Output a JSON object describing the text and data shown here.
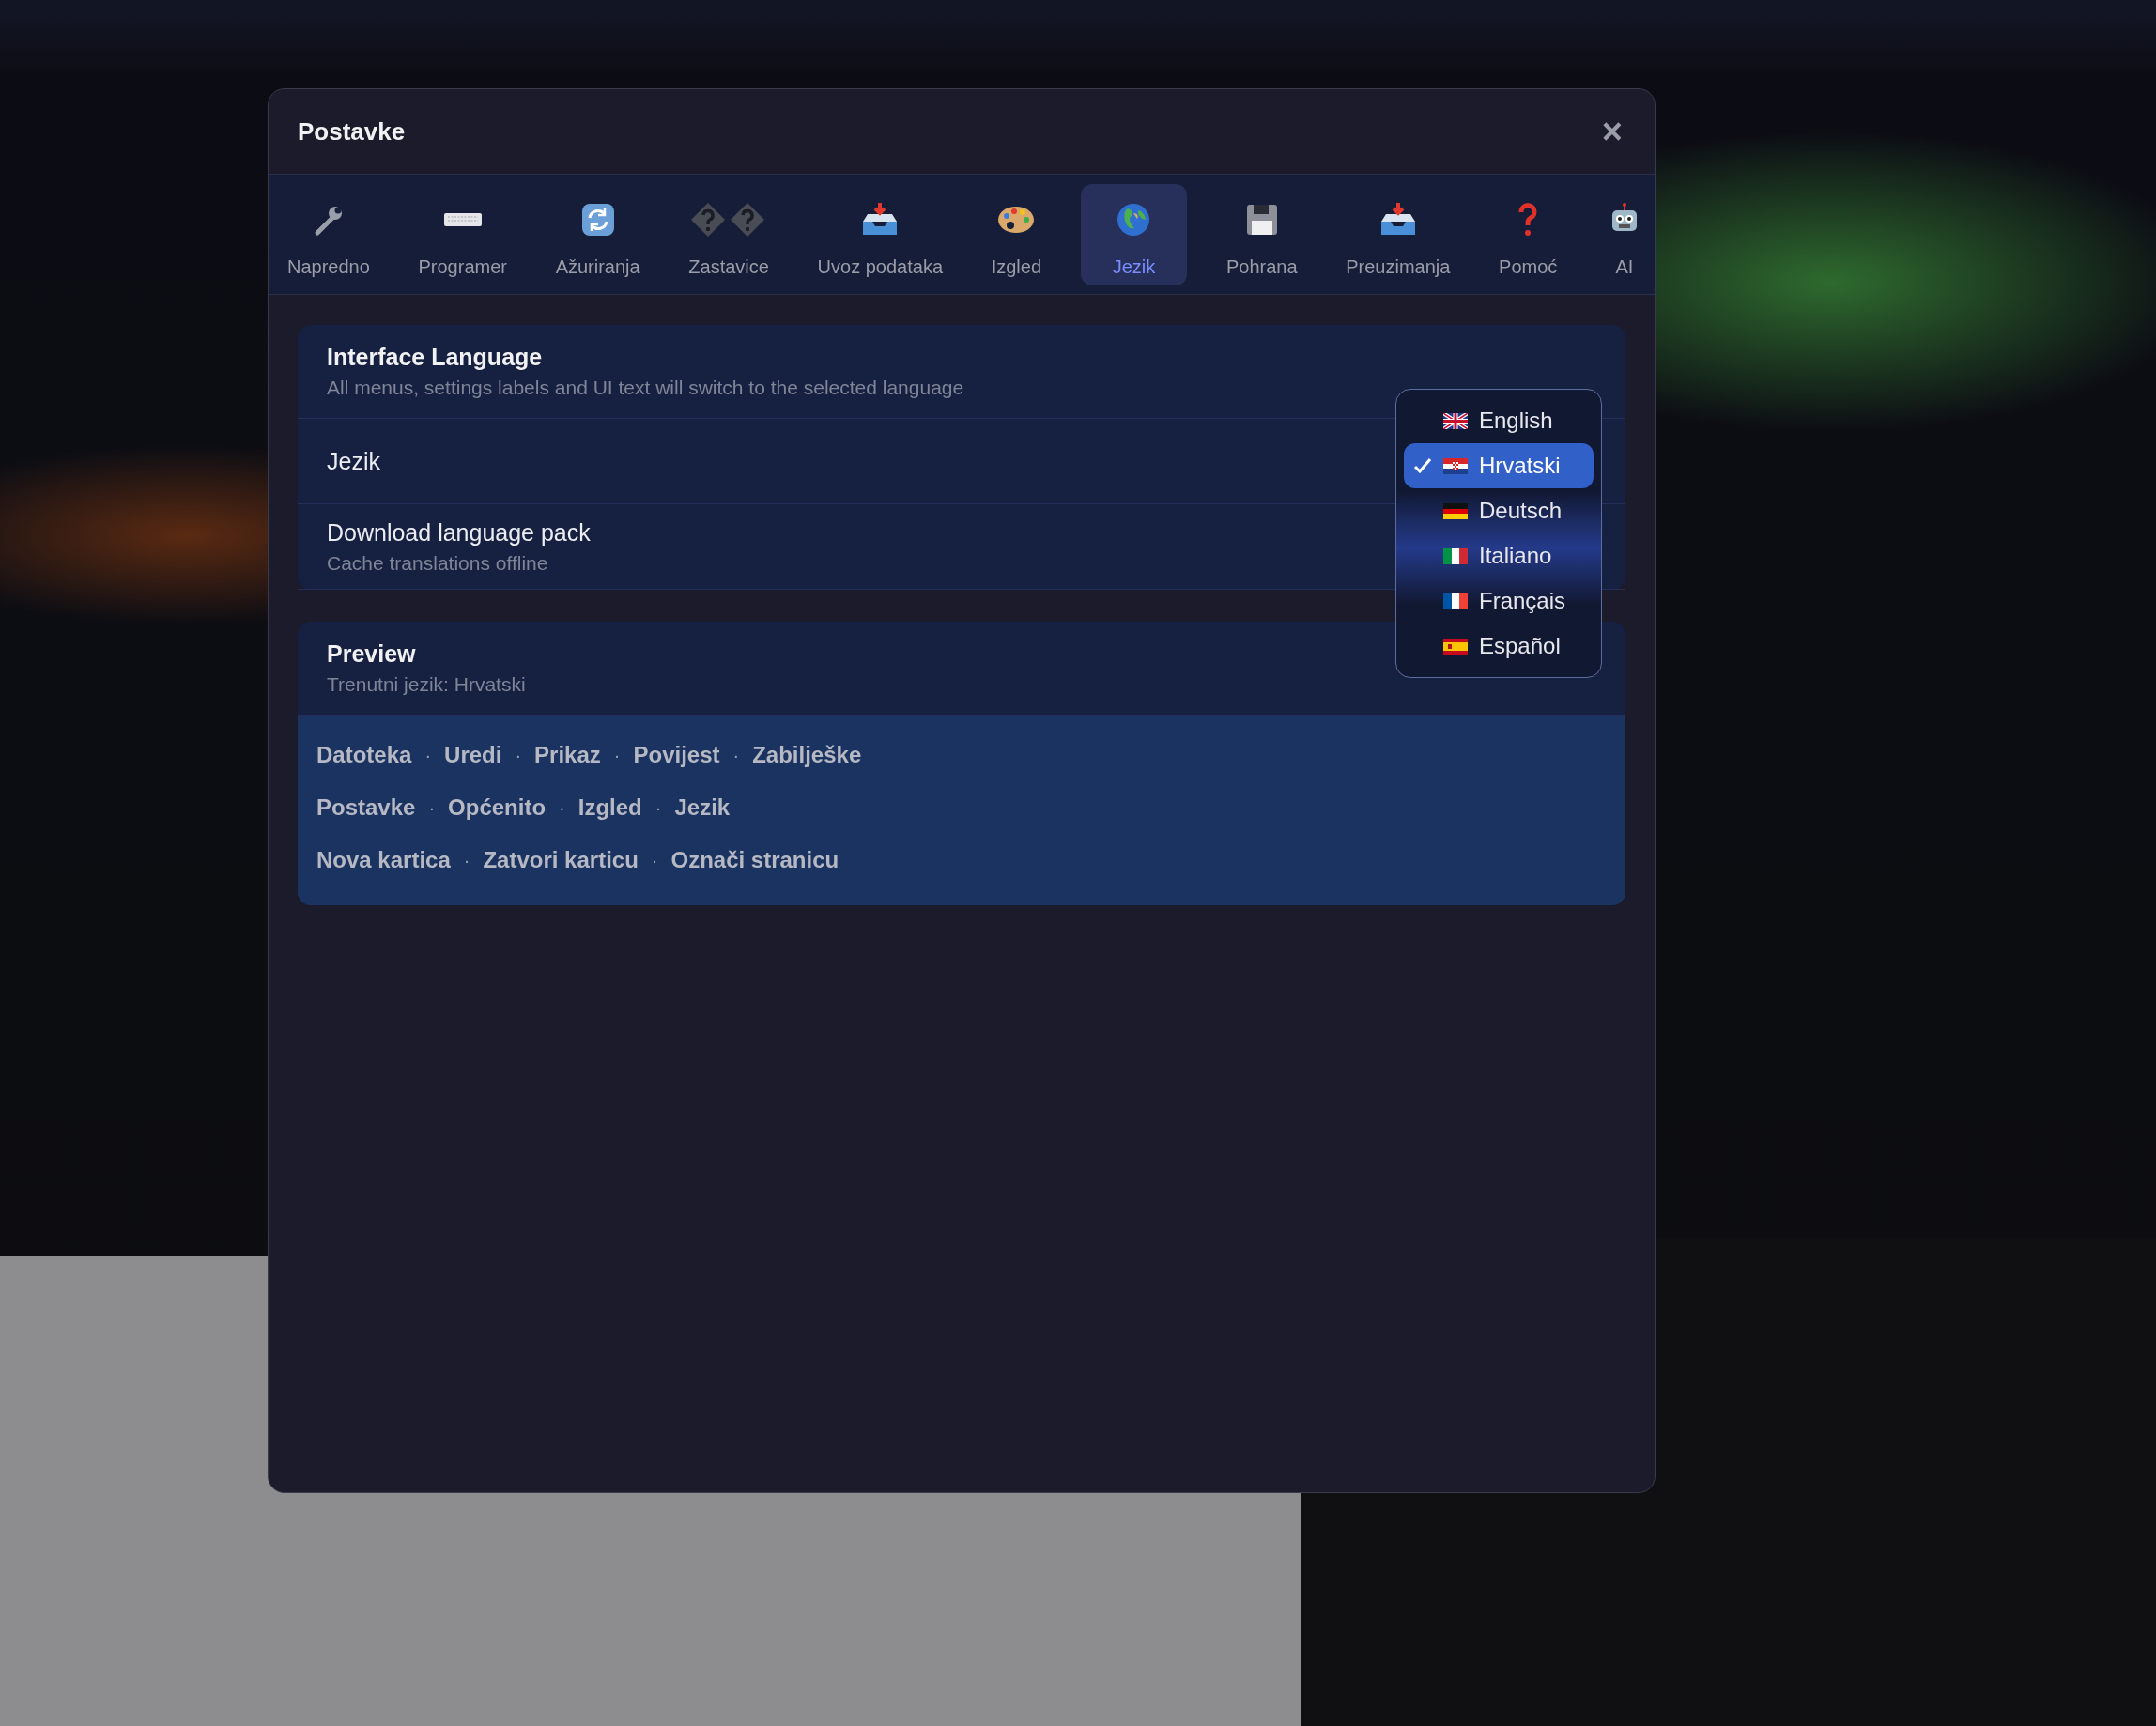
{
  "dialog": {
    "title": "Postavke",
    "close": "×"
  },
  "tabs": [
    {
      "label": "Napredno",
      "selected": false
    },
    {
      "label": "Programer",
      "selected": false
    },
    {
      "label": "Ažuriranja",
      "selected": false
    },
    {
      "label": "Zastavice",
      "selected": false
    },
    {
      "label": "Uvoz podataka",
      "selected": false
    },
    {
      "label": "Izgled",
      "selected": false
    },
    {
      "label": "Jezik",
      "selected": true
    },
    {
      "label": "Pohrana",
      "selected": false
    },
    {
      "label": "Preuzimanja",
      "selected": false
    },
    {
      "label": "Pomoć",
      "selected": false
    },
    {
      "label": "AI",
      "selected": false
    }
  ],
  "language_card": {
    "title": "Interface Language",
    "description": "All menus, settings labels and UI text will switch to the selected language",
    "rows": [
      {
        "label": "Jezik"
      },
      {
        "label": "Download language pack",
        "description": "Cache translations offline"
      }
    ]
  },
  "language_menu": [
    {
      "label": "English",
      "selected": false
    },
    {
      "label": "Hrvatski",
      "selected": true
    },
    {
      "label": "Deutsch",
      "selected": false
    },
    {
      "label": "Italiano",
      "selected": false
    },
    {
      "label": "Français",
      "selected": false
    },
    {
      "label": "Español",
      "selected": false
    }
  ],
  "preview": {
    "title": "Preview",
    "subtitle": "Trenutni jezik: Hrvatski",
    "lines": [
      [
        "Datoteka",
        "·",
        "Uredi",
        "·",
        "Prikaz",
        "·",
        "Povijest",
        "·",
        "Zabilješke"
      ],
      [
        "Postavke",
        "·",
        "Općenito",
        "·",
        "Izgled",
        "·",
        "Jezik"
      ],
      [
        "Nova kartica",
        "·",
        "Zatvori karticu",
        "·",
        "Označi stranicu"
      ]
    ]
  }
}
